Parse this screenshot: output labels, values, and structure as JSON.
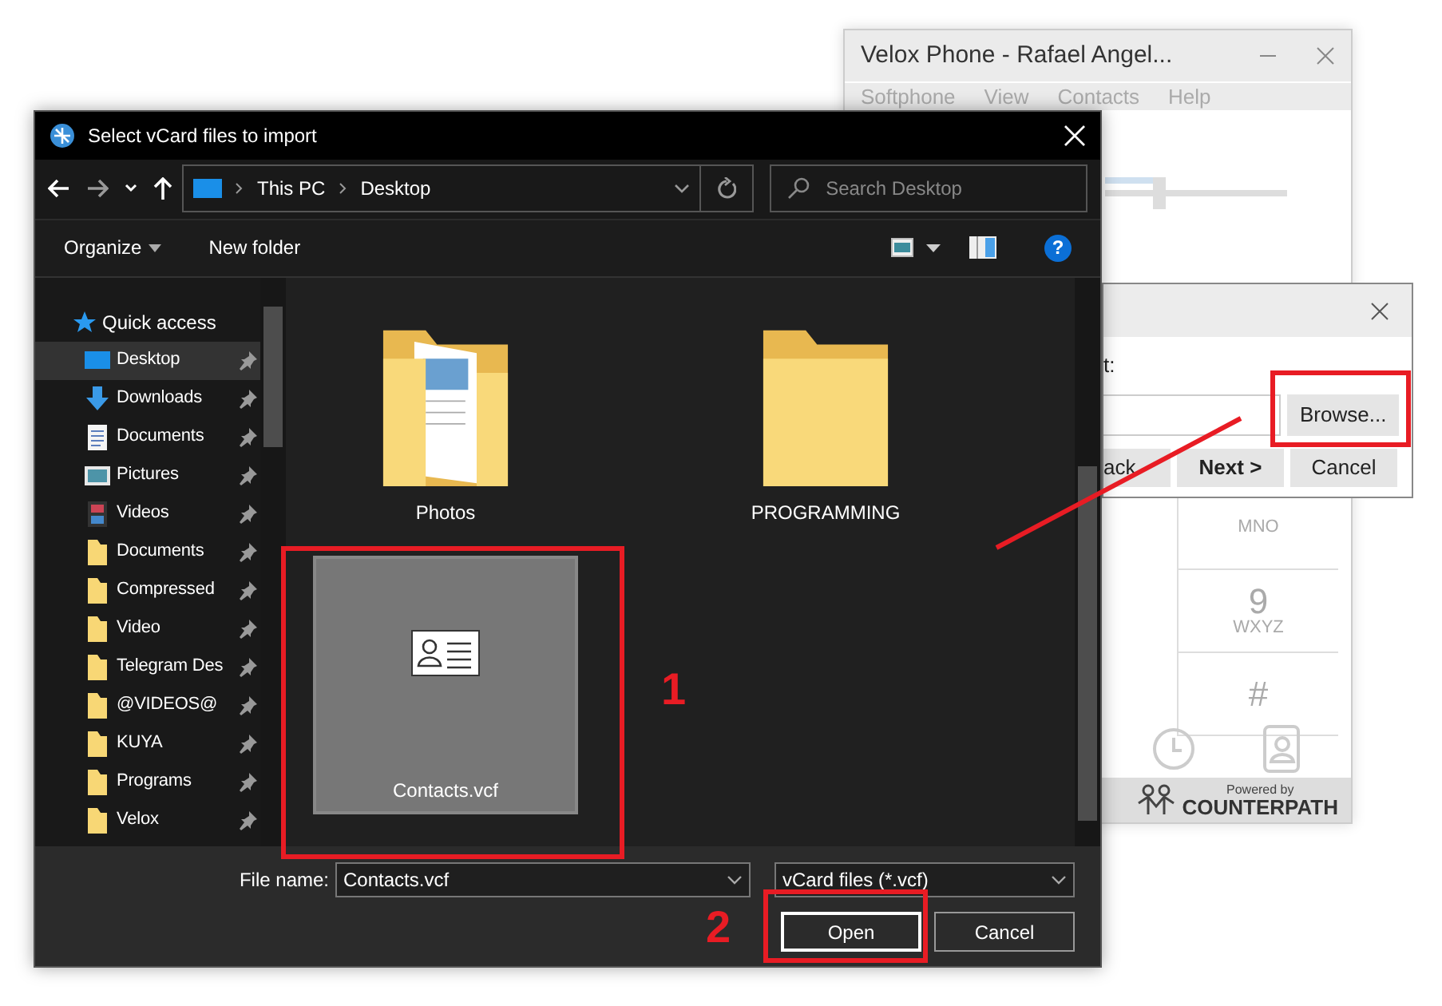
{
  "phone_window": {
    "title": "Velox Phone - Rafael Angel...",
    "menu": [
      "Softphone",
      "View",
      "Contacts",
      "Help"
    ],
    "volume": {
      "level": 0.3
    },
    "keypad": [
      {
        "letters": "MNO"
      },
      {
        "digit": "9",
        "letters": "WXYZ"
      },
      {
        "digit": "#"
      }
    ],
    "footer": {
      "tagline": "Powered by",
      "brand": "COUNTERPATH"
    }
  },
  "import_dialog": {
    "label": "t:",
    "buttons": [
      {
        "label": "Browse...",
        "default": false
      },
      {
        "label": "ack",
        "default": false
      },
      {
        "label": "Next >",
        "default": true
      },
      {
        "label": "Cancel",
        "default": false
      }
    ]
  },
  "file_dialog": {
    "title": "Select vCard files to import",
    "help": "?",
    "breadcrumb": [
      "This PC",
      "Desktop"
    ],
    "search": {
      "placeholder": "Search Desktop"
    },
    "toolbar": [
      {
        "label": "Organize",
        "dropdown": true
      },
      {
        "label": "New folder",
        "dropdown": false
      }
    ],
    "nav": {
      "header": "Quick access",
      "items": [
        {
          "label": "Desktop",
          "kind": "desktop",
          "selected": true
        },
        {
          "label": "Downloads",
          "kind": "download",
          "selected": false
        },
        {
          "label": "Documents",
          "kind": "document",
          "selected": false
        },
        {
          "label": "Pictures",
          "kind": "picture",
          "selected": false
        },
        {
          "label": "Videos",
          "kind": "video",
          "selected": false
        },
        {
          "label": "Documents",
          "kind": "folder",
          "selected": false
        },
        {
          "label": "Compressed",
          "kind": "folder",
          "selected": false
        },
        {
          "label": "Video",
          "kind": "folder",
          "selected": false
        },
        {
          "label": "Telegram Des",
          "kind": "folder",
          "selected": false
        },
        {
          "label": "@VIDEOS@",
          "kind": "folder",
          "selected": false
        },
        {
          "label": "KUYA",
          "kind": "folder",
          "selected": false
        },
        {
          "label": "Programs",
          "kind": "folder",
          "selected": false
        },
        {
          "label": "Velox",
          "kind": "folder",
          "selected": false
        }
      ]
    },
    "files": [
      {
        "name": "Photos",
        "kind": "photos-folder",
        "selected": false
      },
      {
        "name": "PROGRAMMING",
        "kind": "folder",
        "selected": false
      },
      {
        "name": "Contacts.vcf",
        "kind": "vcard",
        "selected": true
      }
    ],
    "file_name": {
      "label": "File name:",
      "value": "Contacts.vcf"
    },
    "file_type": "vCard files (*.vcf)",
    "buttons": [
      {
        "label": "Open",
        "default": true
      },
      {
        "label": "Cancel",
        "default": false
      }
    ]
  },
  "annotations": [
    {
      "label": "1"
    },
    {
      "label": "2"
    }
  ]
}
